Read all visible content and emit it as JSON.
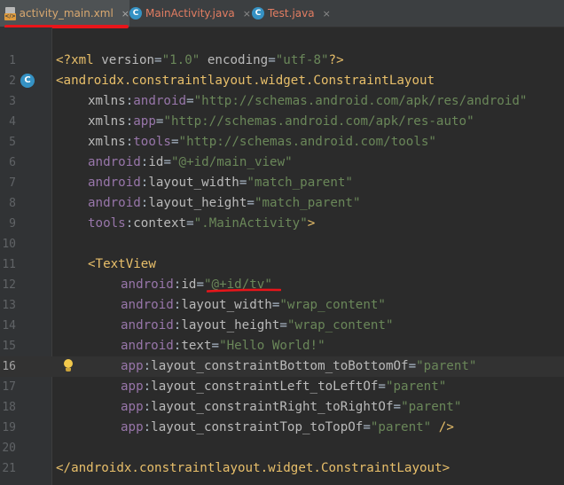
{
  "tabs": [
    {
      "label": "activity_main.xml",
      "icon": "xml-file-icon",
      "active": true
    },
    {
      "label": "MainActivity.java",
      "icon": "class-c-icon",
      "active": false
    },
    {
      "label": "Test.java",
      "icon": "class-c-icon",
      "active": false
    }
  ],
  "tab_close_glyph": "×",
  "gutter_icon_letter": "C",
  "colors": {
    "background": "#2b2b2b",
    "tag": "#e8bf6a",
    "namespace": "#9876aa",
    "attribute": "#bababa",
    "string": "#6a8759",
    "annotation_red": "#e8151a"
  },
  "current_line": 16,
  "lines": [
    {
      "n": "1",
      "indent": 0,
      "parts": [
        {
          "t": "<?xml ",
          "c": "pi"
        },
        {
          "t": "version",
          "c": "attr"
        },
        {
          "t": "=",
          "c": "text"
        },
        {
          "t": "\"1.0\"",
          "c": "val"
        },
        {
          "t": " ",
          "c": "text"
        },
        {
          "t": "encoding",
          "c": "attr"
        },
        {
          "t": "=",
          "c": "text"
        },
        {
          "t": "\"utf-8\"",
          "c": "val"
        },
        {
          "t": "?>",
          "c": "pi"
        }
      ]
    },
    {
      "n": "2",
      "indent": 0,
      "parts": [
        {
          "t": "<androidx.constraintlayout.widget.ConstraintLayout",
          "c": "tag-c"
        }
      ]
    },
    {
      "n": "3",
      "indent": 1,
      "parts": [
        {
          "t": "xmlns",
          "c": "attr"
        },
        {
          "t": ":",
          "c": "text"
        },
        {
          "t": "android",
          "c": "ns"
        },
        {
          "t": "=",
          "c": "text"
        },
        {
          "t": "\"http://schemas.android.com/apk/res/android\"",
          "c": "val"
        }
      ]
    },
    {
      "n": "4",
      "indent": 1,
      "parts": [
        {
          "t": "xmlns",
          "c": "attr"
        },
        {
          "t": ":",
          "c": "text"
        },
        {
          "t": "app",
          "c": "ns"
        },
        {
          "t": "=",
          "c": "text"
        },
        {
          "t": "\"http://schemas.android.com/apk/res-auto\"",
          "c": "val"
        }
      ]
    },
    {
      "n": "5",
      "indent": 1,
      "parts": [
        {
          "t": "xmlns",
          "c": "attr"
        },
        {
          "t": ":",
          "c": "text"
        },
        {
          "t": "tools",
          "c": "ns"
        },
        {
          "t": "=",
          "c": "text"
        },
        {
          "t": "\"http://schemas.android.com/tools\"",
          "c": "val"
        }
      ]
    },
    {
      "n": "6",
      "indent": 1,
      "parts": [
        {
          "t": "android",
          "c": "ns"
        },
        {
          "t": ":",
          "c": "text"
        },
        {
          "t": "id",
          "c": "attr"
        },
        {
          "t": "=",
          "c": "text"
        },
        {
          "t": "\"@+id/main_view\"",
          "c": "val"
        }
      ]
    },
    {
      "n": "7",
      "indent": 1,
      "parts": [
        {
          "t": "android",
          "c": "ns"
        },
        {
          "t": ":",
          "c": "text"
        },
        {
          "t": "layout_width",
          "c": "attr"
        },
        {
          "t": "=",
          "c": "text"
        },
        {
          "t": "\"match_parent\"",
          "c": "val"
        }
      ]
    },
    {
      "n": "8",
      "indent": 1,
      "parts": [
        {
          "t": "android",
          "c": "ns"
        },
        {
          "t": ":",
          "c": "text"
        },
        {
          "t": "layout_height",
          "c": "attr"
        },
        {
          "t": "=",
          "c": "text"
        },
        {
          "t": "\"match_parent\"",
          "c": "val"
        }
      ]
    },
    {
      "n": "9",
      "indent": 1,
      "parts": [
        {
          "t": "tools",
          "c": "ns"
        },
        {
          "t": ":",
          "c": "text"
        },
        {
          "t": "context",
          "c": "attr"
        },
        {
          "t": "=",
          "c": "text"
        },
        {
          "t": "\".MainActivity\"",
          "c": "val"
        },
        {
          "t": ">",
          "c": "tag-c"
        }
      ]
    },
    {
      "n": "10",
      "indent": 0,
      "parts": []
    },
    {
      "n": "11",
      "indent": 1,
      "parts": [
        {
          "t": "<TextView",
          "c": "tag-c"
        }
      ]
    },
    {
      "n": "12",
      "indent": 2,
      "parts": [
        {
          "t": "android",
          "c": "ns"
        },
        {
          "t": ":",
          "c": "text"
        },
        {
          "t": "id",
          "c": "attr"
        },
        {
          "t": "=",
          "c": "text"
        },
        {
          "t": "\"@+id/tv\"",
          "c": "val"
        }
      ]
    },
    {
      "n": "13",
      "indent": 2,
      "parts": [
        {
          "t": "android",
          "c": "ns"
        },
        {
          "t": ":",
          "c": "text"
        },
        {
          "t": "layout_width",
          "c": "attr"
        },
        {
          "t": "=",
          "c": "text"
        },
        {
          "t": "\"wrap_content\"",
          "c": "val"
        }
      ]
    },
    {
      "n": "14",
      "indent": 2,
      "parts": [
        {
          "t": "android",
          "c": "ns"
        },
        {
          "t": ":",
          "c": "text"
        },
        {
          "t": "layout_height",
          "c": "attr"
        },
        {
          "t": "=",
          "c": "text"
        },
        {
          "t": "\"wrap_content\"",
          "c": "val"
        }
      ]
    },
    {
      "n": "15",
      "indent": 2,
      "parts": [
        {
          "t": "android",
          "c": "ns"
        },
        {
          "t": ":",
          "c": "text"
        },
        {
          "t": "text",
          "c": "attr"
        },
        {
          "t": "=",
          "c": "text"
        },
        {
          "t": "\"Hello World!\"",
          "c": "val"
        }
      ]
    },
    {
      "n": "16",
      "indent": 2,
      "parts": [
        {
          "t": "app",
          "c": "ns"
        },
        {
          "t": ":",
          "c": "text"
        },
        {
          "t": "layout_constraintBottom_toBottomOf",
          "c": "attr"
        },
        {
          "t": "=",
          "c": "text"
        },
        {
          "t": "\"parent\"",
          "c": "val"
        }
      ]
    },
    {
      "n": "17",
      "indent": 2,
      "parts": [
        {
          "t": "app",
          "c": "ns"
        },
        {
          "t": ":",
          "c": "text"
        },
        {
          "t": "layout_constraintLeft_toLeftOf",
          "c": "attr"
        },
        {
          "t": "=",
          "c": "text"
        },
        {
          "t": "\"parent\"",
          "c": "val"
        }
      ]
    },
    {
      "n": "18",
      "indent": 2,
      "parts": [
        {
          "t": "app",
          "c": "ns"
        },
        {
          "t": ":",
          "c": "text"
        },
        {
          "t": "layout_constraintRight_toRightOf",
          "c": "attr"
        },
        {
          "t": "=",
          "c": "text"
        },
        {
          "t": "\"parent\"",
          "c": "val"
        }
      ]
    },
    {
      "n": "19",
      "indent": 2,
      "parts": [
        {
          "t": "app",
          "c": "ns"
        },
        {
          "t": ":",
          "c": "text"
        },
        {
          "t": "layout_constraintTop_toTopOf",
          "c": "attr"
        },
        {
          "t": "=",
          "c": "text"
        },
        {
          "t": "\"parent\"",
          "c": "val"
        },
        {
          "t": " />",
          "c": "tag-c"
        }
      ]
    },
    {
      "n": "20",
      "indent": 0,
      "parts": []
    },
    {
      "n": "21",
      "indent": 0,
      "parts": [
        {
          "t": "</androidx.constraintlayout.widget.ConstraintLayout>",
          "c": "tag-c"
        }
      ]
    }
  ]
}
